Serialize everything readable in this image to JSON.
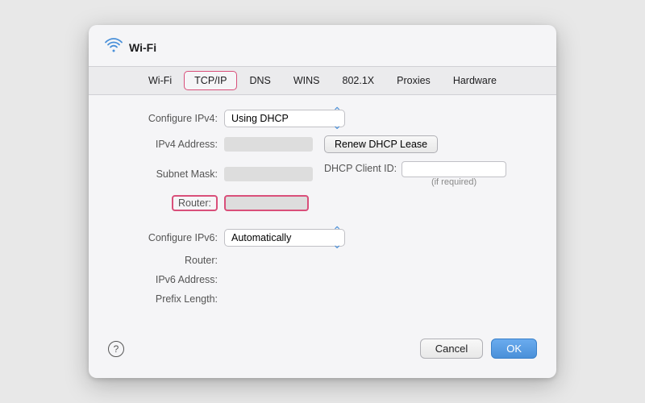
{
  "window": {
    "title": "Wi-Fi"
  },
  "tabs": [
    {
      "id": "wifi",
      "label": "Wi-Fi",
      "active": false
    },
    {
      "id": "tcpip",
      "label": "TCP/IP",
      "active": true
    },
    {
      "id": "dns",
      "label": "DNS",
      "active": false
    },
    {
      "id": "wins",
      "label": "WINS",
      "active": false
    },
    {
      "id": "8021x",
      "label": "802.1X",
      "active": false
    },
    {
      "id": "proxies",
      "label": "Proxies",
      "active": false
    },
    {
      "id": "hardware",
      "label": "Hardware",
      "active": false
    }
  ],
  "ipv4": {
    "configure_label": "Configure IPv4:",
    "configure_value": "Using DHCP",
    "address_label": "IPv4 Address:",
    "subnet_label": "Subnet Mask:",
    "router_label": "Router:",
    "renew_btn": "Renew DHCP Lease",
    "dhcp_client_label": "DHCP Client ID:",
    "if_required": "(if required)"
  },
  "ipv6": {
    "configure_label": "Configure IPv6:",
    "configure_value": "Automatically",
    "router_label": "Router:",
    "address_label": "IPv6 Address:",
    "prefix_label": "Prefix Length:"
  },
  "footer": {
    "help": "?",
    "cancel": "Cancel",
    "ok": "OK"
  }
}
